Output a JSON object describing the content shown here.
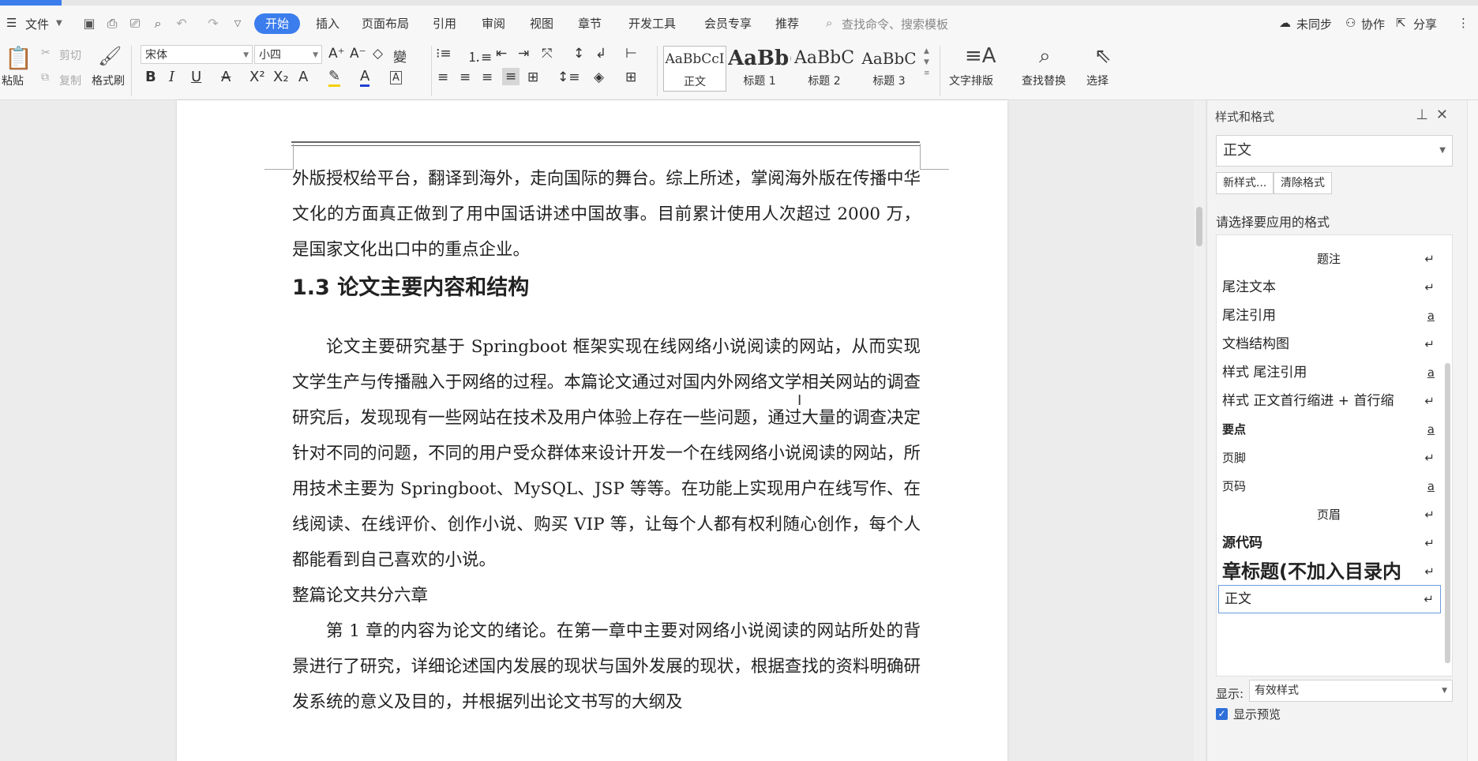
{
  "menu": {
    "file_label": "文件",
    "tabs": [
      {
        "label": "开始",
        "active": true
      },
      {
        "label": "插入"
      },
      {
        "label": "页面布局"
      },
      {
        "label": "引用"
      },
      {
        "label": "审阅"
      },
      {
        "label": "视图"
      },
      {
        "label": "章节"
      },
      {
        "label": "开发工具"
      },
      {
        "label": "会员专享"
      },
      {
        "label": "推荐"
      }
    ],
    "search_placeholder": "查找命令、搜索模板",
    "sync_label": "未同步",
    "collab_label": "协作",
    "share_label": "分享"
  },
  "ribbon": {
    "paste_label": "粘贴",
    "cut_label": "剪切",
    "copy_label": "复制",
    "format_painter_label": "格式刷",
    "font_name": "宋体",
    "font_size": "小四",
    "styles": [
      {
        "preview": "AaBbCcI",
        "name": "正文"
      },
      {
        "preview": "AaBb(",
        "name": "标题 1"
      },
      {
        "preview": "AaBbC",
        "name": "标题 2"
      },
      {
        "preview": "AaBbC",
        "name": "标题 3"
      }
    ],
    "text_layout_label": "文字排版",
    "find_replace_label": "查找替换",
    "select_label": "选择"
  },
  "document": {
    "para1": "外版授权给平台，翻译到海外，走向国际的舞台。综上所述，掌阅海外版在传播中华文化的方面真正做到了用中国话讲述中国故事。目前累计使用人次超过 2000 万，是国家文化出口中的重点企业。",
    "heading": "1.3  论文主要内容和结构",
    "para2": "论文主要研究基于 Springboot 框架实现在线网络小说阅读的网站，从而实现文学生产与传播融入于网络的过程。本篇论文通过对国内外网络文学相关网站的调查研究后，发现现有一些网站在技术及用户体验上存在一些问题，通过大量的调查决定针对不同的问题，不同的用户受众群体来设计开发一个在线网络小说阅读的网站，所用技术主要为 Springboot、MySQL、JSP 等等。在功能上实现用户在线写作、在线阅读、在线评价、创作小说、购买 VIP 等，让每个人都有权利随心创作，每个人都能看到自己喜欢的小说。",
    "para3": "整篇论文共分六章",
    "para4": "第 1 章的内容为论文的绪论。在第一章中主要对网络小说阅读的网站所处的背景进行了研究，详细论述国内发展的现状与国外发展的现状，根据查找的资料明确研发系统的意义及目的，并根据列出论文书写的大纲及"
  },
  "pane": {
    "title": "样式和格式",
    "current_style": "正文",
    "new_style_label": "新样式...",
    "clear_format_label": "清除格式",
    "prompt": "请选择要应用的格式",
    "items": [
      {
        "label": "题注",
        "mark": "↵"
      },
      {
        "label": " 尾注文本",
        "mark": "↵"
      },
      {
        "label": "尾注引用",
        "mark": "a"
      },
      {
        "label": "文档结构图",
        "mark": "↵"
      },
      {
        "label": "样式  尾注引用",
        "mark": "a"
      },
      {
        "label": "样式  正文首行缩进 + 首行缩",
        "mark": "↵"
      },
      {
        "label": "要点",
        "mark": "a"
      },
      {
        "label": "页脚",
        "mark": "↵"
      },
      {
        "label": "页码",
        "mark": "a"
      },
      {
        "label": "页眉",
        "mark": "↵"
      },
      {
        "label": "源代码",
        "mark": "↵"
      },
      {
        "label": "章标题(不加入目录内",
        "mark": "↵"
      },
      {
        "label": "正文",
        "mark": "↵"
      }
    ],
    "show_label": "显示:",
    "show_value": "有效样式",
    "preview_label": "显示预览"
  }
}
